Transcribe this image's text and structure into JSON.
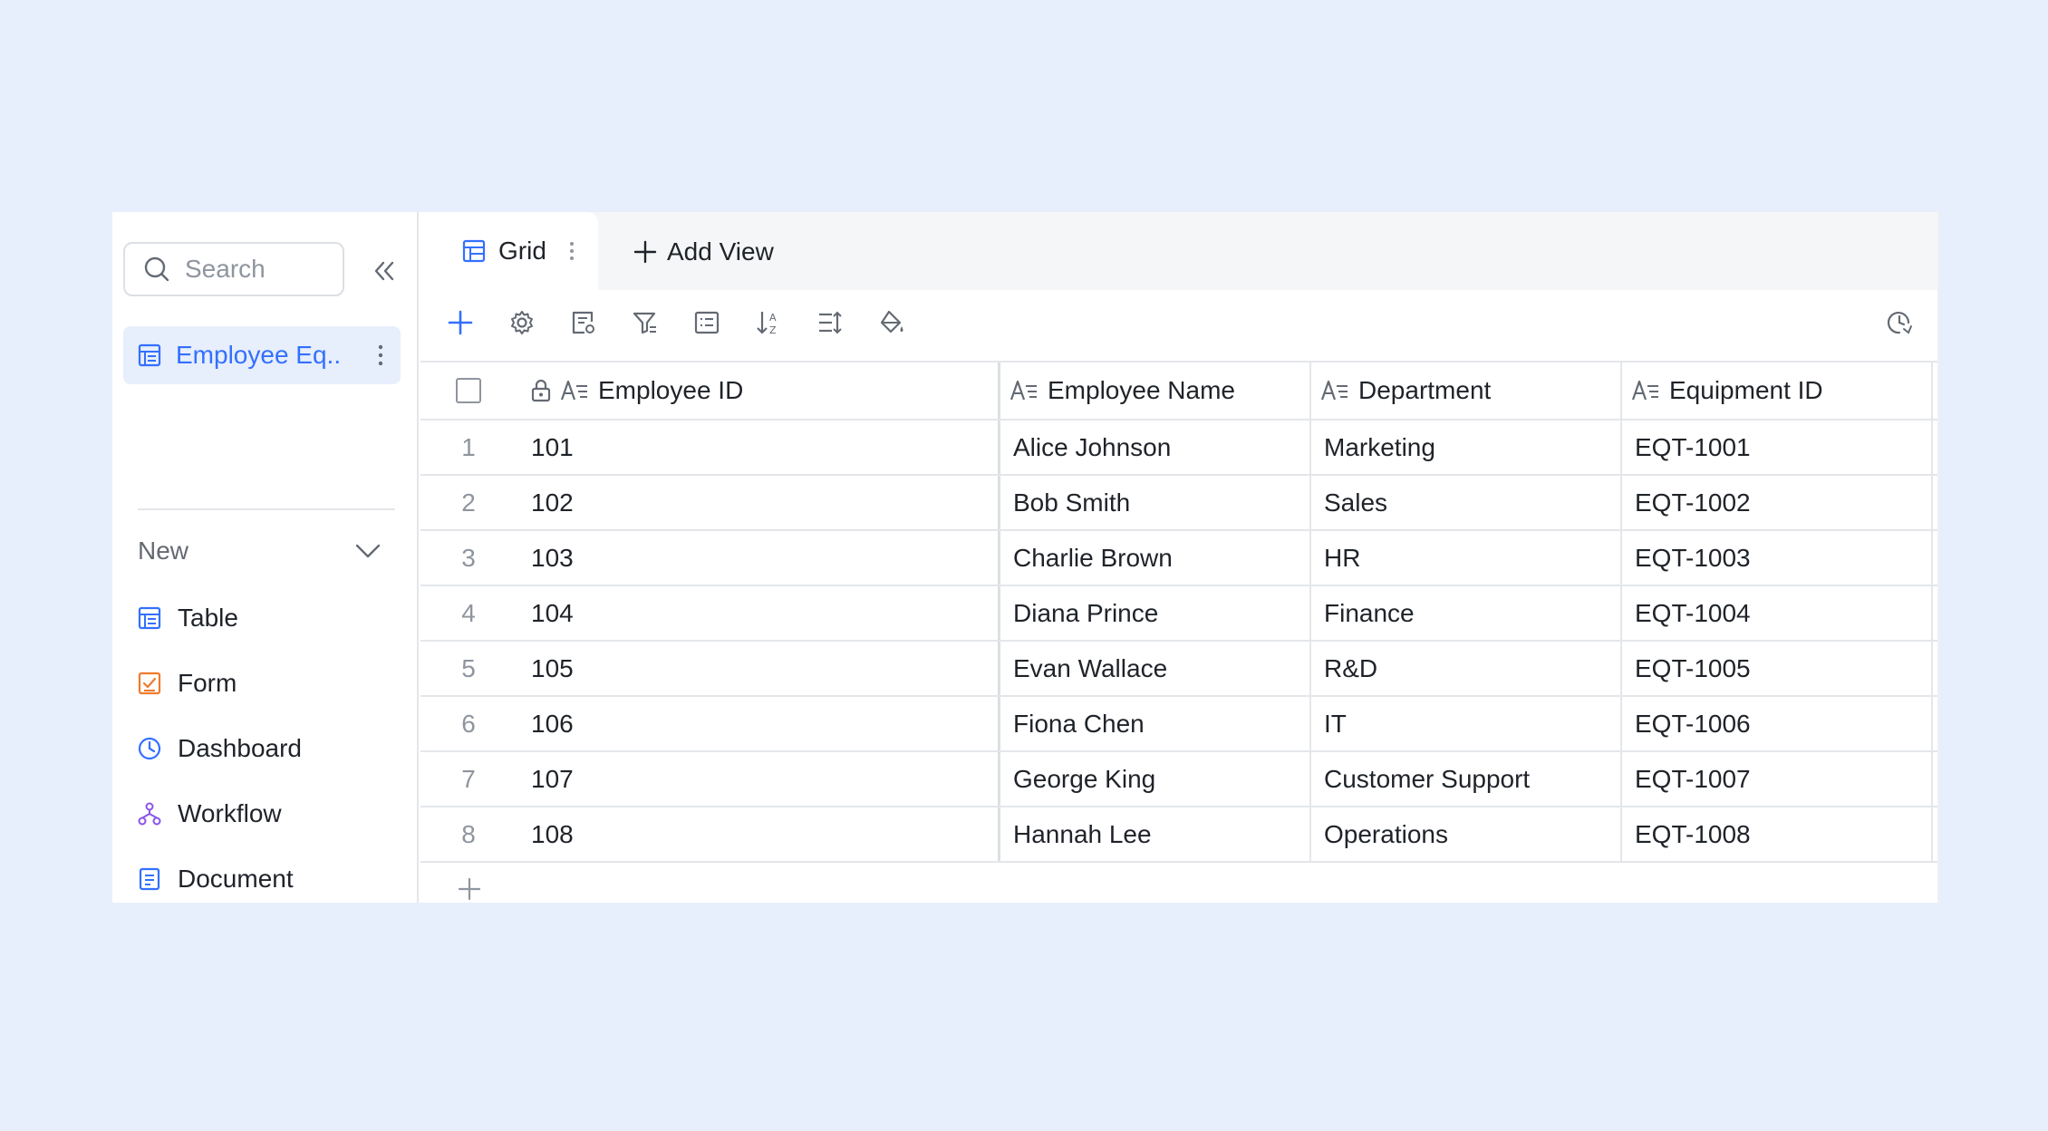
{
  "sidebar": {
    "search": {
      "placeholder": "Search"
    },
    "tables": [
      {
        "label": "Employee Eq..."
      }
    ],
    "new_section": {
      "label": "New"
    },
    "create_items": [
      {
        "label": "Table",
        "icon": "table-icon"
      },
      {
        "label": "Form",
        "icon": "form-icon"
      },
      {
        "label": "Dashboard",
        "icon": "dashboard-icon"
      },
      {
        "label": "Workflow",
        "icon": "workflow-icon"
      },
      {
        "label": "Document",
        "icon": "document-icon"
      }
    ]
  },
  "tabs": {
    "active": {
      "label": "Grid"
    },
    "add_view": {
      "label": "Add View"
    }
  },
  "toolbar": {
    "buttons": [
      "add-record-icon",
      "settings-icon",
      "field-config-icon",
      "filter-icon",
      "group-icon",
      "sort-icon",
      "row-height-icon",
      "fill-color-icon"
    ],
    "history": "history-icon"
  },
  "grid": {
    "columns": [
      "Employee ID",
      "Employee Name",
      "Department",
      "Equipment ID"
    ],
    "rows": [
      {
        "num": "1",
        "id": "101",
        "name": "Alice Johnson",
        "dept": "Marketing",
        "equip": "EQT-1001"
      },
      {
        "num": "2",
        "id": "102",
        "name": "Bob Smith",
        "dept": "Sales",
        "equip": "EQT-1002"
      },
      {
        "num": "3",
        "id": "103",
        "name": "Charlie Brown",
        "dept": "HR",
        "equip": "EQT-1003"
      },
      {
        "num": "4",
        "id": "104",
        "name": "Diana Prince",
        "dept": "Finance",
        "equip": "EQT-1004"
      },
      {
        "num": "5",
        "id": "105",
        "name": "Evan Wallace",
        "dept": "R&D",
        "equip": "EQT-1005"
      },
      {
        "num": "6",
        "id": "106",
        "name": "Fiona Chen",
        "dept": "IT",
        "equip": "EQT-1006"
      },
      {
        "num": "7",
        "id": "107",
        "name": "George King",
        "dept": "Customer Support",
        "equip": "EQT-1007"
      },
      {
        "num": "8",
        "id": "108",
        "name": "Hannah Lee",
        "dept": "Operations",
        "equip": "EQT-1008"
      }
    ]
  },
  "colors": {
    "accent": "#3370ff",
    "page_bg": "#e8effc",
    "form_icon": "#f07b2b",
    "workflow_icon": "#8a54e8",
    "selected_bg": "#e7eefc"
  }
}
